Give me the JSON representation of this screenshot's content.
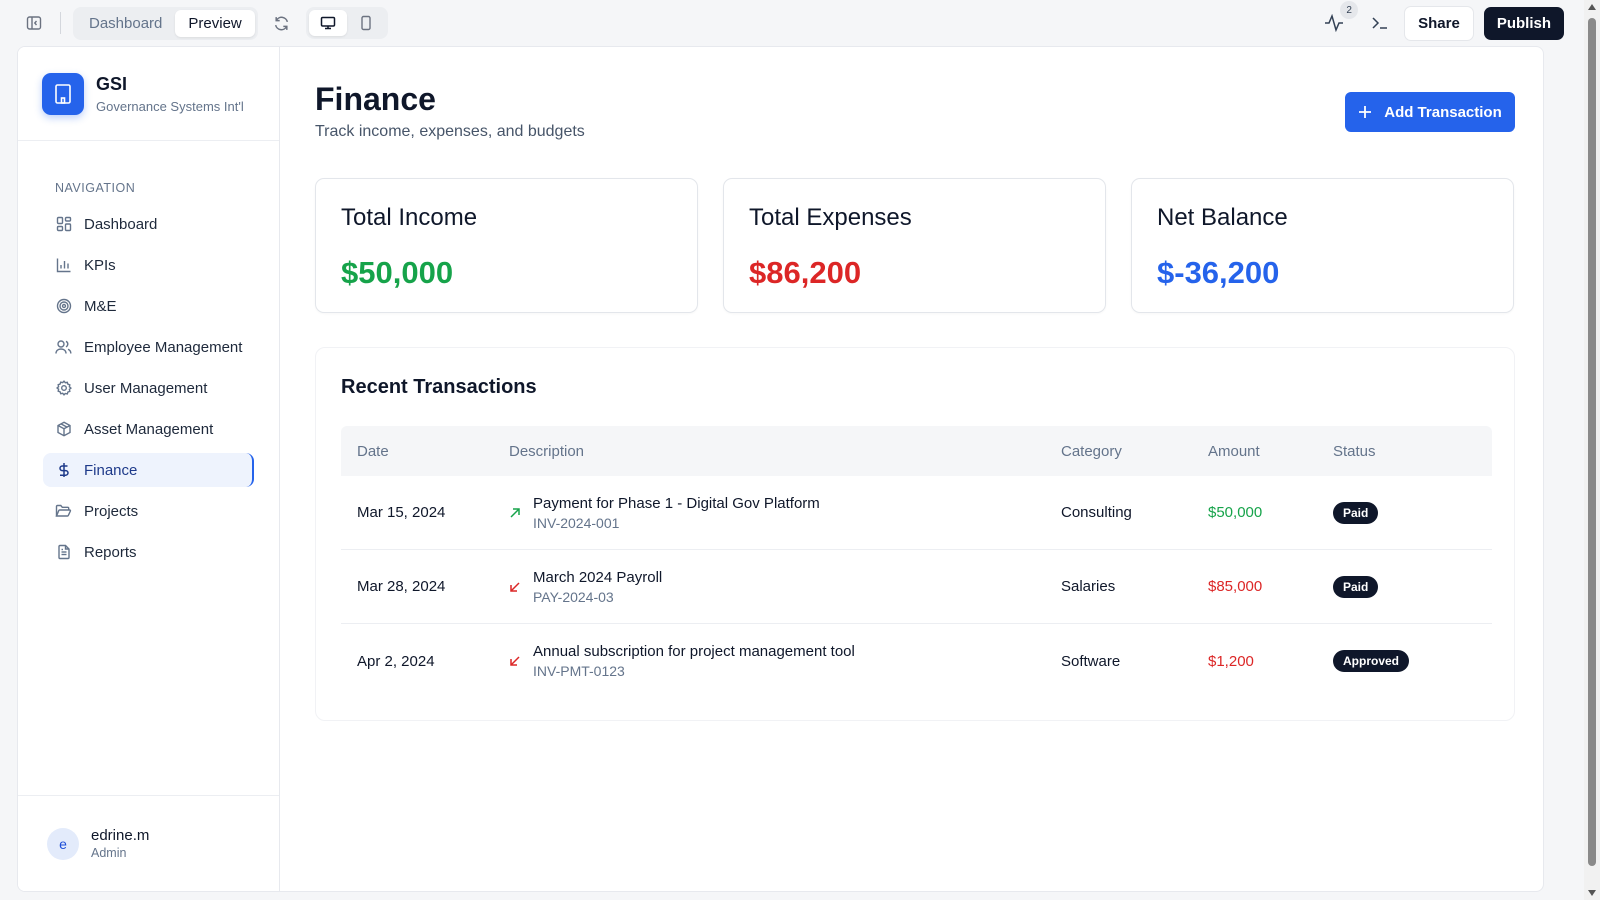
{
  "topbar": {
    "tab_dashboard": "Dashboard",
    "tab_preview": "Preview",
    "activity_count": "2",
    "share_label": "Share",
    "publish_label": "Publish"
  },
  "brand": {
    "name": "GSI",
    "subtitle": "Governance Systems Int'l",
    "accent": "#2563eb"
  },
  "sidebar": {
    "section_title": "NAVIGATION",
    "items": [
      {
        "label": "Dashboard",
        "icon": "grid-icon"
      },
      {
        "label": "KPIs",
        "icon": "bar-chart-icon"
      },
      {
        "label": "M&E",
        "icon": "target-icon"
      },
      {
        "label": "Employee Management",
        "icon": "users-icon"
      },
      {
        "label": "User Management",
        "icon": "gear-icon"
      },
      {
        "label": "Asset Management",
        "icon": "box-icon"
      },
      {
        "label": "Finance",
        "icon": "dollar-icon",
        "active": true
      },
      {
        "label": "Projects",
        "icon": "folder-icon"
      },
      {
        "label": "Reports",
        "icon": "file-icon"
      }
    ]
  },
  "user": {
    "initial": "e",
    "name": "edrine.m",
    "role": "Admin"
  },
  "page": {
    "title": "Finance",
    "subtitle": "Track income, expenses, and budgets",
    "add_button": "Add Transaction"
  },
  "summary": [
    {
      "label": "Total Income",
      "value": "$50,000",
      "color": "#16a34a"
    },
    {
      "label": "Total Expenses",
      "value": "$86,200",
      "color": "#dc2626"
    },
    {
      "label": "Net Balance",
      "value": "$-36,200",
      "color": "#2563eb"
    }
  ],
  "transactions": {
    "title": "Recent Transactions",
    "columns": [
      "Date",
      "Description",
      "Category",
      "Amount",
      "Status"
    ],
    "rows": [
      {
        "date": "Mar 15, 2024",
        "direction": "income",
        "description": "Payment for Phase 1 - Digital Gov Platform",
        "ref": "INV-2024-001",
        "category": "Consulting",
        "amount": "$50,000",
        "amount_color": "#16a34a",
        "status": "Paid"
      },
      {
        "date": "Mar 28, 2024",
        "direction": "expense",
        "description": "March 2024 Payroll",
        "ref": "PAY-2024-03",
        "category": "Salaries",
        "amount": "$85,000",
        "amount_color": "#dc2626",
        "status": "Paid"
      },
      {
        "date": "Apr 2, 2024",
        "direction": "expense",
        "description": "Annual subscription for project management tool",
        "ref": "INV-PMT-0123",
        "category": "Software",
        "amount": "$1,200",
        "amount_color": "#dc2626",
        "status": "Approved"
      }
    ]
  }
}
